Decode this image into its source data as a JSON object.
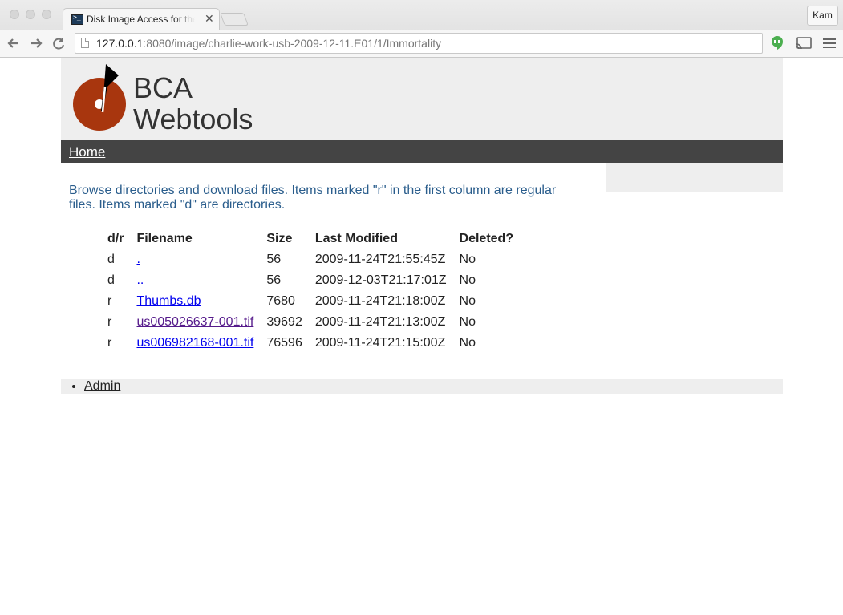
{
  "browser": {
    "tab_title": "Disk Image Access for the Web",
    "profile_name": "Kam",
    "url_host": "127.0.0.1",
    "url_rest": ":8080/image/charlie-work-usb-2009-12-11.E01/1/Immortality"
  },
  "site": {
    "title_line1": "BCA",
    "title_line2": "Webtools",
    "logo_colors": {
      "disc": "#a8360e",
      "needle": "#000000"
    },
    "nav_home": "Home",
    "intro_text": "Browse directories and download files. Items marked \"r\" in the first column are regular files. Items marked \"d\" are directories."
  },
  "table": {
    "headers": [
      "d/r",
      "Filename",
      "Size",
      "Last Modified",
      "Deleted?"
    ],
    "rows": [
      {
        "type": "d",
        "name": ".",
        "size": "56",
        "modified": "2009-11-24T21:55:45Z",
        "deleted": "No",
        "visited": false
      },
      {
        "type": "d",
        "name": "..",
        "size": "56",
        "modified": "2009-12-03T21:17:01Z",
        "deleted": "No",
        "visited": false
      },
      {
        "type": "r",
        "name": "Thumbs.db",
        "size": "7680",
        "modified": "2009-11-24T21:18:00Z",
        "deleted": "No",
        "visited": false
      },
      {
        "type": "r",
        "name": "us005026637-001.tif",
        "size": "39692",
        "modified": "2009-11-24T21:13:00Z",
        "deleted": "No",
        "visited": true
      },
      {
        "type": "r",
        "name": "us006982168-001.tif",
        "size": "76596",
        "modified": "2009-11-24T21:15:00Z",
        "deleted": "No",
        "visited": false
      }
    ]
  },
  "footer": {
    "admin_link": "Admin"
  }
}
